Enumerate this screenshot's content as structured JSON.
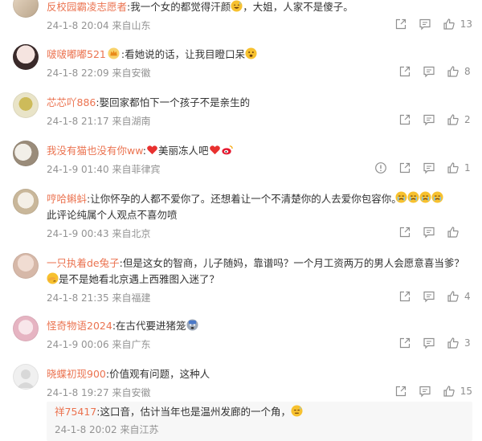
{
  "comments": [
    {
      "user": "反校园霸凌志愿者",
      "text": ":我一个女的都觉得汗颜",
      "text_after": "，大姐，人家不是傻子。",
      "date": "24-1-8 20:04",
      "source": "来自山东",
      "likes": "13"
    },
    {
      "user": "啵啵嘟嘟521",
      "text": ":看她说的话，让我目瞪口呆",
      "date": "24-1-8 22:09",
      "source": "来自安徽",
      "likes": "8"
    },
    {
      "user": "芯芯吖886",
      "text": ":娶回家都怕下一个孩子不是亲生的",
      "date": "24-1-8 21:17",
      "source": "来自湖南",
      "likes": "2"
    },
    {
      "user": "我没有猫也没有你ww",
      "text": ":",
      "text_after": "美丽冻人吧",
      "date": "24-1-9 01:40",
      "source": "来自菲律宾",
      "likes": "1"
    },
    {
      "user": "哼哈蝌蚪",
      "text": ":让你怀孕的人都不爱你了。还想着让一个不清楚你的人去爱你包容你。",
      "line2": "此评论纯属个人观点不喜勿喷",
      "date": "24-1-9 00:43",
      "source": "来自北京",
      "likes": ""
    },
    {
      "user": "一只执着de兔子",
      "text": ":但是这女的智商，儿子随妈，靠谱吗？一个月工资两万的男人会愿意喜当爹？",
      "line2": "是不是她看北京遇上西雅图入迷了？",
      "date": "24-1-8 21:35",
      "source": "来自福建",
      "likes": "4"
    },
    {
      "user": "怪奇物语2024",
      "text": ":在古代要进猪笼",
      "date": "24-1-9 00:06",
      "source": "来自广东",
      "likes": "3"
    },
    {
      "user": "晓蝶初现900",
      "text": ":价值观有问题，这种人",
      "date": "24-1-8 19:27",
      "source": "来自安徽",
      "likes": "15"
    }
  ],
  "reply": {
    "user": "祥75417",
    "text": ":这口音，估计当年也是温州发廊的一个角，",
    "date": "24-1-8 20:02",
    "source": "来自江苏"
  },
  "colors": {
    "username": "#eb7350",
    "meta": "#939393",
    "reply_bg": "#f7f7f7"
  }
}
